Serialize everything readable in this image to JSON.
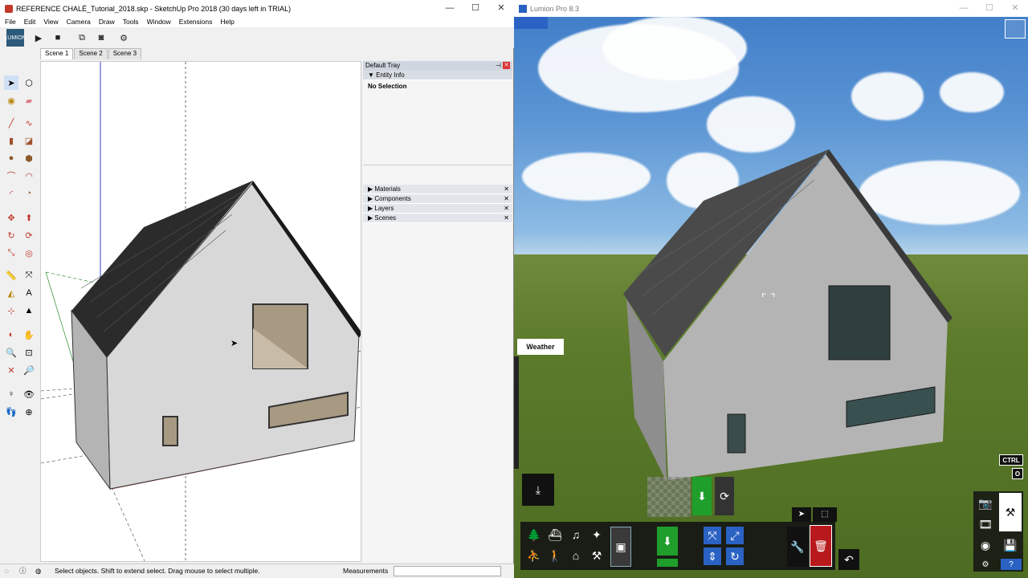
{
  "sketchup": {
    "title": "REFERENCE CHALÉ_Tutorial_2018.skp - SketchUp Pro 2018 (30 days left in TRIAL)",
    "menu": [
      "File",
      "Edit",
      "View",
      "Camera",
      "Draw",
      "Tools",
      "Window",
      "Extensions",
      "Help"
    ],
    "scenes": [
      "Scene 1",
      "Scene 2",
      "Scene 3"
    ],
    "tray": {
      "title": "Default Tray",
      "entity_info": "Entity Info",
      "selection": "No Selection",
      "sections": [
        "Materials",
        "Components",
        "Layers",
        "Scenes"
      ]
    },
    "status": {
      "hint": "Select objects. Shift to extend select. Drag mouse to select multiple.",
      "measurements_label": "Measurements"
    },
    "logo_text": "LUMION"
  },
  "lumion": {
    "title": "Lumion Pro 8.3",
    "weather_label": "Weather",
    "ctrl_label": "CTRL",
    "key_label": "O",
    "help_label": "?"
  },
  "colors": {
    "tray_header": "#cfd6e0",
    "sky": "#4a88cf",
    "grass": "#5c7b2b",
    "save_green": "#1f9e2c",
    "delete_red": "#b8191c",
    "lumion_blue": "#2a62c4"
  }
}
